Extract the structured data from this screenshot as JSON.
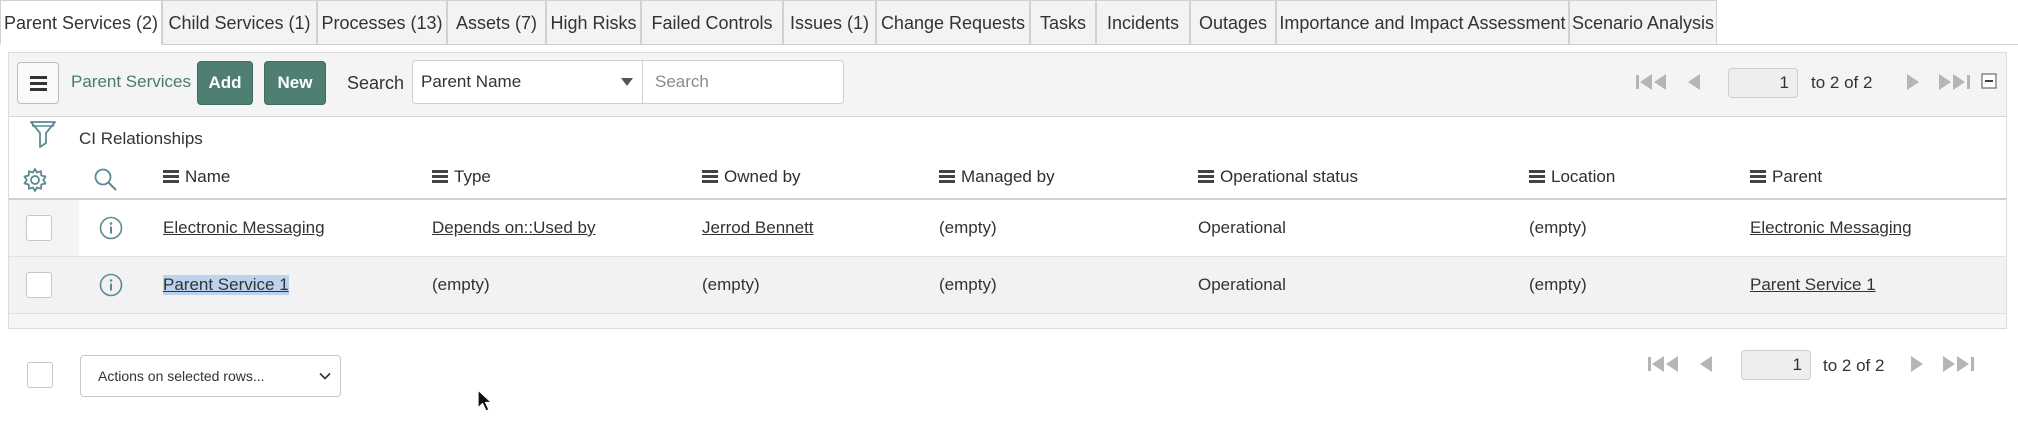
{
  "tabs": [
    {
      "label": "Parent Services (2)",
      "active": true
    },
    {
      "label": "Child Services (1)"
    },
    {
      "label": "Processes (13)"
    },
    {
      "label": "Assets (7)"
    },
    {
      "label": "High Risks"
    },
    {
      "label": "Failed Controls"
    },
    {
      "label": "Issues (1)"
    },
    {
      "label": "Change Requests"
    },
    {
      "label": "Tasks"
    },
    {
      "label": "Incidents"
    },
    {
      "label": "Outages"
    },
    {
      "label": "Importance and Impact Assessment"
    },
    {
      "label": "Scenario Analysis"
    }
  ],
  "toolbar": {
    "list_title": "Parent Services",
    "add_label": "Add",
    "new_label": "New",
    "search_label": "Search",
    "search_field": "Parent Name",
    "search_placeholder": "Search",
    "page_value": "1",
    "page_of": "to 2 of 2"
  },
  "filter": {
    "breadcrumb": "CI Relationships"
  },
  "columns": [
    "Name",
    "Type",
    "Owned by",
    "Managed by",
    "Operational status",
    "Location",
    "Parent"
  ],
  "rows": [
    {
      "name": "Electronic Messaging",
      "type": "Depends on::Used by",
      "owned_by": "Jerrod Bennett",
      "managed_by": "(empty)",
      "status": "Operational",
      "location": "(empty)",
      "parent": "Electronic Messaging"
    },
    {
      "name": "Parent Service 1",
      "type": "(empty)",
      "owned_by": "(empty)",
      "managed_by": "(empty)",
      "status": "Operational",
      "location": "(empty)",
      "parent": "Parent Service 1"
    }
  ],
  "footer": {
    "actions_label": "Actions on selected rows...",
    "page_value": "1",
    "page_of": "to 2 of 2"
  },
  "colors": {
    "accent": "#4f7e73",
    "link_title": "#4a7a6c",
    "icon": "#5a8a94",
    "selection": "#bcd3ee"
  }
}
